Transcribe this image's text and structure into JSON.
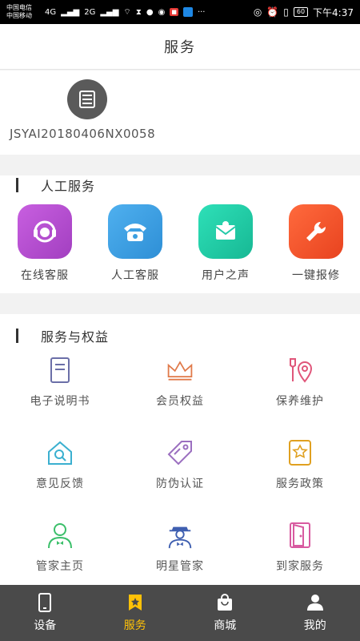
{
  "status_bar": {
    "carrier_1": "中国电信",
    "carrier_2": "中国移动",
    "net_1": "4G",
    "net_2": "2G",
    "more": "···",
    "battery": "60",
    "time": "下午4:37"
  },
  "header": {
    "title": "服务"
  },
  "device": {
    "id": "JSYAI20180406NX0058",
    "icon": "device-icon"
  },
  "manual_service": {
    "title": "人工服务",
    "items": [
      {
        "label": "在线客服",
        "icon": "headset-icon",
        "color": "#b94fd0"
      },
      {
        "label": "人工客服",
        "icon": "phone-icon",
        "color": "#3b9fe0"
      },
      {
        "label": "用户之声",
        "icon": "mail-icon",
        "color": "#23c9a8"
      },
      {
        "label": "一键报修",
        "icon": "wrench-icon",
        "color": "#f0552b"
      }
    ]
  },
  "benefits": {
    "title": "服务与权益",
    "items": [
      {
        "label": "电子说明书",
        "icon": "book-icon",
        "color": "#6b6fa8"
      },
      {
        "label": "会员权益",
        "icon": "crown-icon",
        "color": "#e07a4a"
      },
      {
        "label": "保养维护",
        "icon": "maintenance-icon",
        "color": "#e0567a"
      },
      {
        "label": "意见反馈",
        "icon": "feedback-icon",
        "color": "#3bb0d0"
      },
      {
        "label": "防伪认证",
        "icon": "tag-icon",
        "color": "#9b6fc0"
      },
      {
        "label": "服务政策",
        "icon": "policy-icon",
        "color": "#e0a020"
      },
      {
        "label": "管家主页",
        "icon": "butler-icon",
        "color": "#3bbf6a"
      },
      {
        "label": "明星管家",
        "icon": "star-butler-icon",
        "color": "#3f5fb0"
      },
      {
        "label": "到家服务",
        "icon": "door-icon",
        "color": "#d85aa0"
      }
    ]
  },
  "bottom_nav": {
    "items": [
      {
        "label": "设备",
        "icon": "phone-device-icon"
      },
      {
        "label": "服务",
        "icon": "bookmark-icon",
        "active": true
      },
      {
        "label": "商城",
        "icon": "shopping-bag-icon"
      },
      {
        "label": "我的",
        "icon": "user-icon"
      }
    ],
    "active_color": "#ffc107"
  }
}
